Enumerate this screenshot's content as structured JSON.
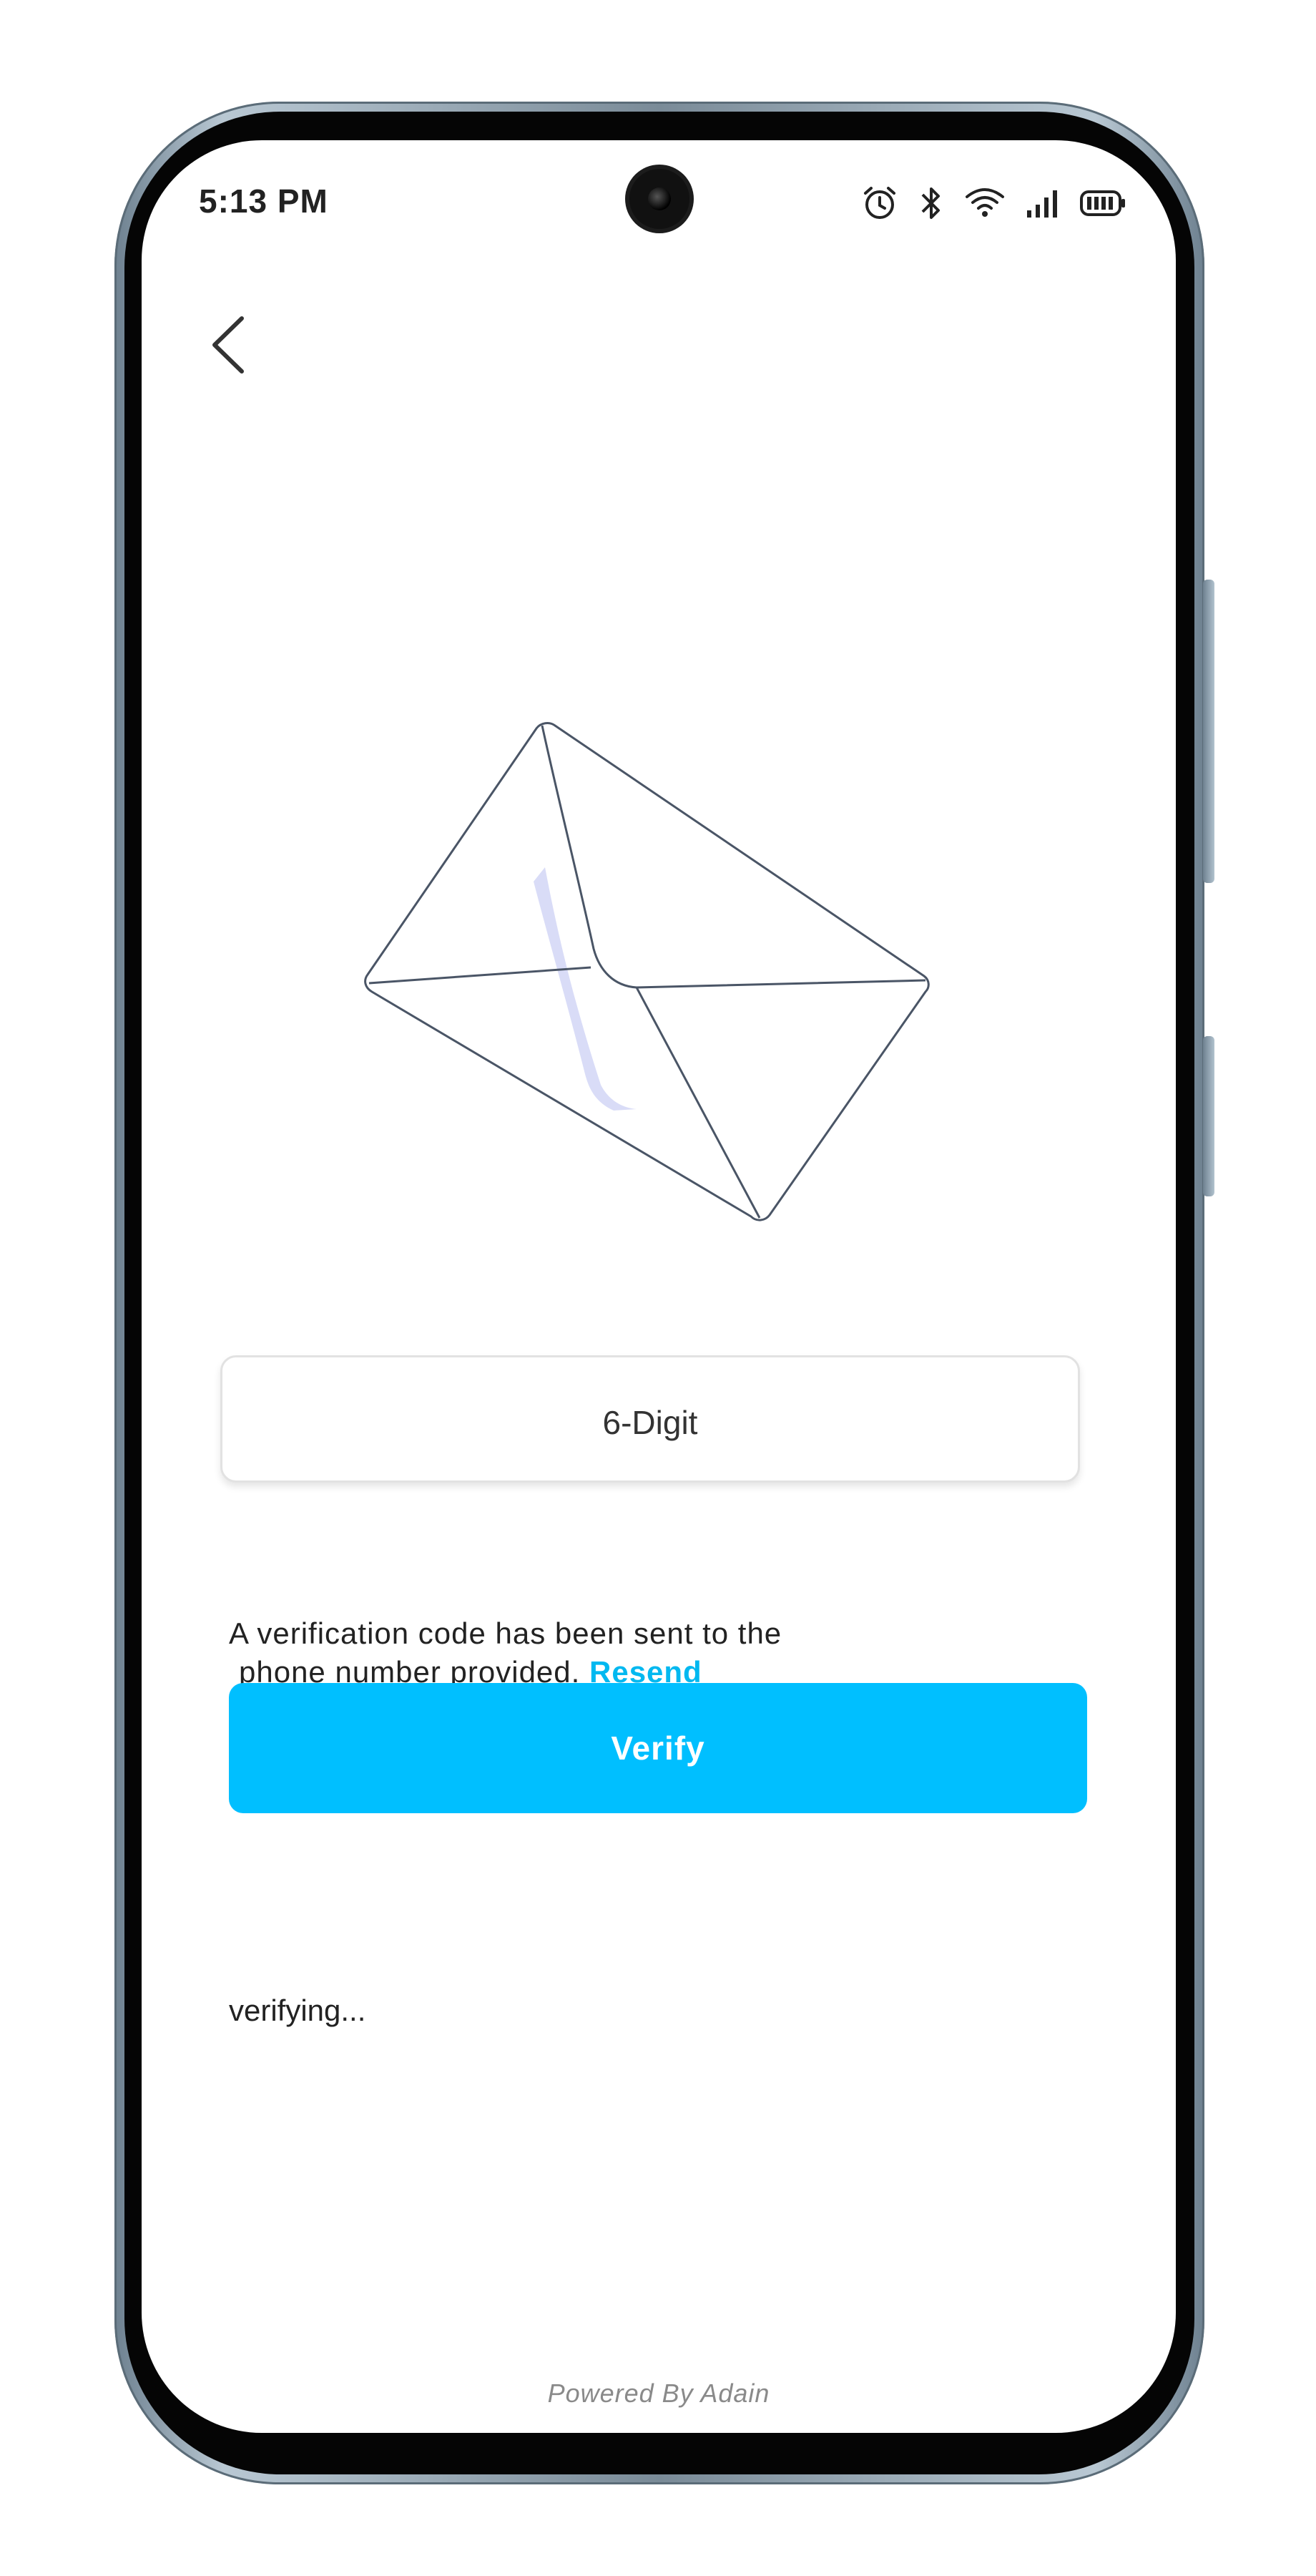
{
  "status_bar": {
    "time": "5:13 PM",
    "icons": [
      "alarm-icon",
      "bluetooth-icon",
      "wifi-icon",
      "signal-icon",
      "battery-icon"
    ]
  },
  "navigation": {
    "back_icon": "chevron-left-icon"
  },
  "illustration": {
    "icon": "envelope-icon",
    "accent_color": "#d9dcf7",
    "stroke_color": "#4a5566"
  },
  "code_input": {
    "placeholder": "6-Digit",
    "value": ""
  },
  "info": {
    "line1": "A verification code has been sent to the",
    "line2": "phone number provided.",
    "resend_label": "Resend"
  },
  "verify_button": {
    "label": "Verify",
    "color": "#00bfff"
  },
  "status_message": "verifying...",
  "footer": "Powered By Adain",
  "colors": {
    "accent": "#00b8f0",
    "text": "#222222"
  }
}
